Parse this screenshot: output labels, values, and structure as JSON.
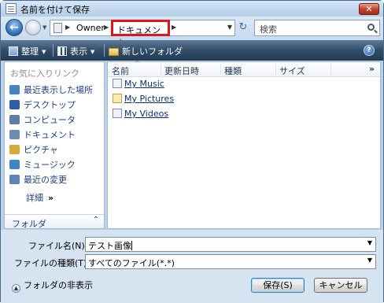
{
  "window": {
    "title": "名前を付けて保存",
    "close_label": "✕"
  },
  "nav": {
    "breadcrumb": [
      "Owner",
      "ドキュメント"
    ],
    "search_placeholder": "検索"
  },
  "toolbar": {
    "organize": "整理",
    "views": "表示",
    "new_folder": "新しいフォルダ",
    "help": "?"
  },
  "favorites": {
    "header": "お気に入りリンク",
    "items": [
      {
        "label": "最近表示した場所",
        "icon": "recent-places-icon",
        "color": "#4a7fc0"
      },
      {
        "label": "デスクトップ",
        "icon": "desktop-icon",
        "color": "#2b5ea7"
      },
      {
        "label": "コンピュータ",
        "icon": "computer-icon",
        "color": "#5a7fa8"
      },
      {
        "label": "ドキュメント",
        "icon": "documents-icon",
        "color": "#6d8bb0"
      },
      {
        "label": "ピクチャ",
        "icon": "pictures-icon",
        "color": "#d9a83a"
      },
      {
        "label": "ミュージック",
        "icon": "music-icon",
        "color": "#3e86c6"
      },
      {
        "label": "最近の変更",
        "icon": "recent-changes-icon",
        "color": "#5c86b8"
      }
    ],
    "more_label": "詳細",
    "more_chevron": "»"
  },
  "folder_bar": {
    "label": "フォルダ",
    "caret": "⌃"
  },
  "columns": [
    "名前",
    "更新日時",
    "種類",
    "サイズ"
  ],
  "more_columns": "»",
  "files": [
    {
      "name": "My Music",
      "icon": "music-folder-icon"
    },
    {
      "name": "My Pictures",
      "icon": "pictures-folder-icon"
    },
    {
      "name": "My Videos",
      "icon": "videos-folder-icon"
    }
  ],
  "form": {
    "filename_label": "ファイル名(N):",
    "filename_value": "テスト画像",
    "filetype_label": "ファイルの種類(T):",
    "filetype_value": "すべてのファイル(*.*)"
  },
  "footer": {
    "hide_folders": "フォルダの非表示",
    "save": "保存(S)",
    "cancel": "キャンセル"
  }
}
